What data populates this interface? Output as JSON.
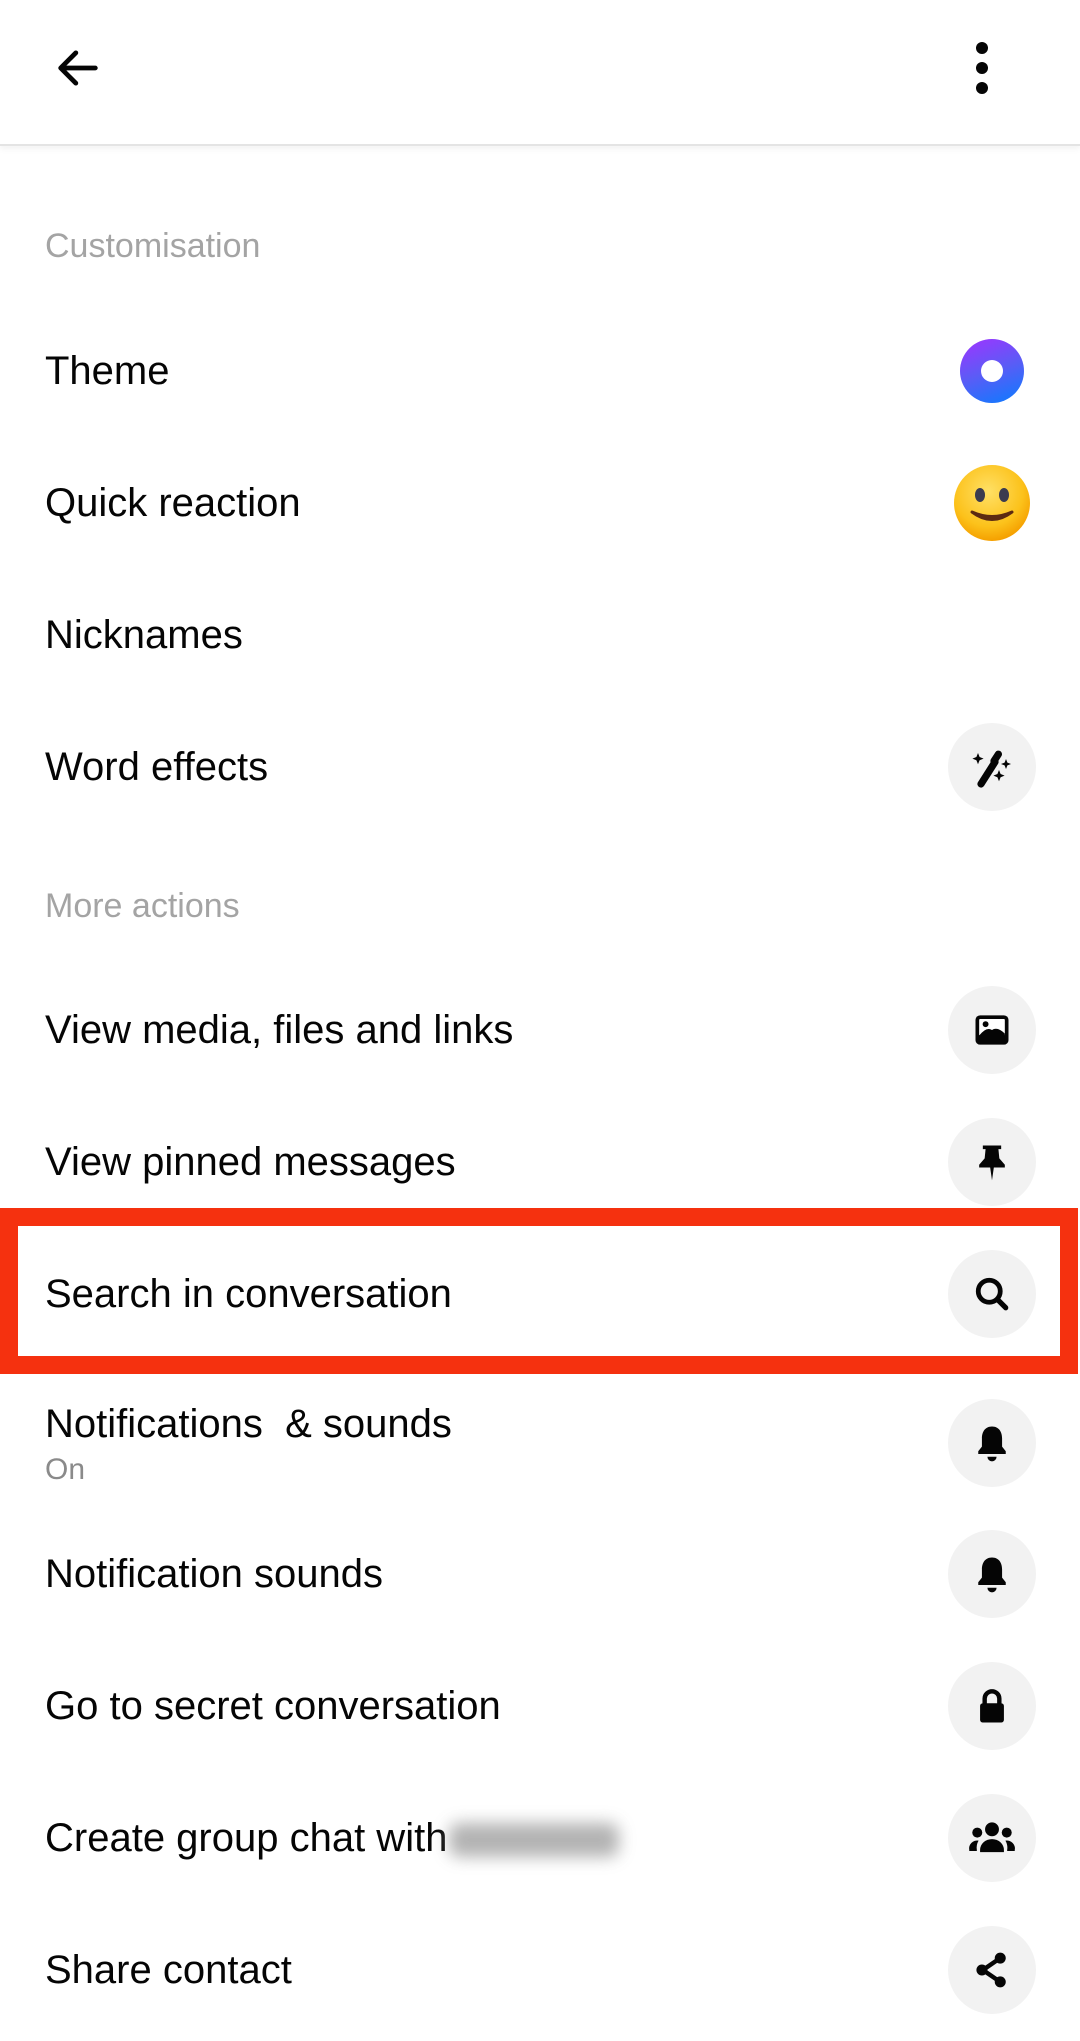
{
  "header": {
    "back_icon": "arrow-left-icon",
    "more_icon": "more-vertical-icon"
  },
  "sections": [
    {
      "title": "Customisation",
      "items": [
        {
          "label": "Theme",
          "icon": "theme-ring-icon",
          "theme_gradient": [
            "#a033ff",
            "#0a7cff"
          ]
        },
        {
          "label": "Quick reaction",
          "icon": "smiley-emoji-icon",
          "emoji": "🙂"
        },
        {
          "label": "Nicknames",
          "icon": null
        },
        {
          "label": "Word effects",
          "icon": "magic-wand-sparkles-icon"
        }
      ]
    },
    {
      "title": "More actions",
      "items": [
        {
          "label": "View media, files and links",
          "icon": "image-icon"
        },
        {
          "label": "View pinned messages",
          "icon": "pin-icon"
        },
        {
          "label": "Search in conversation",
          "icon": "search-icon",
          "highlighted": true
        },
        {
          "label": "Notifications  & sounds",
          "sublabel": "On",
          "icon": "bell-icon"
        },
        {
          "label": "Notification sounds",
          "icon": "bell-icon"
        },
        {
          "label": "Go to secret conversation",
          "icon": "lock-icon"
        },
        {
          "label": "Create group chat with",
          "redacted_name": "[blurred]",
          "icon": "group-icon"
        },
        {
          "label": "Share contact",
          "icon": "share-icon"
        }
      ]
    }
  ],
  "colors": {
    "highlight_border": "#f5310f",
    "section_title": "#a4a4a4",
    "icon_circle_bg": "#f2f2f2",
    "text_primary": "#050505",
    "text_secondary": "#8a8a8a"
  }
}
